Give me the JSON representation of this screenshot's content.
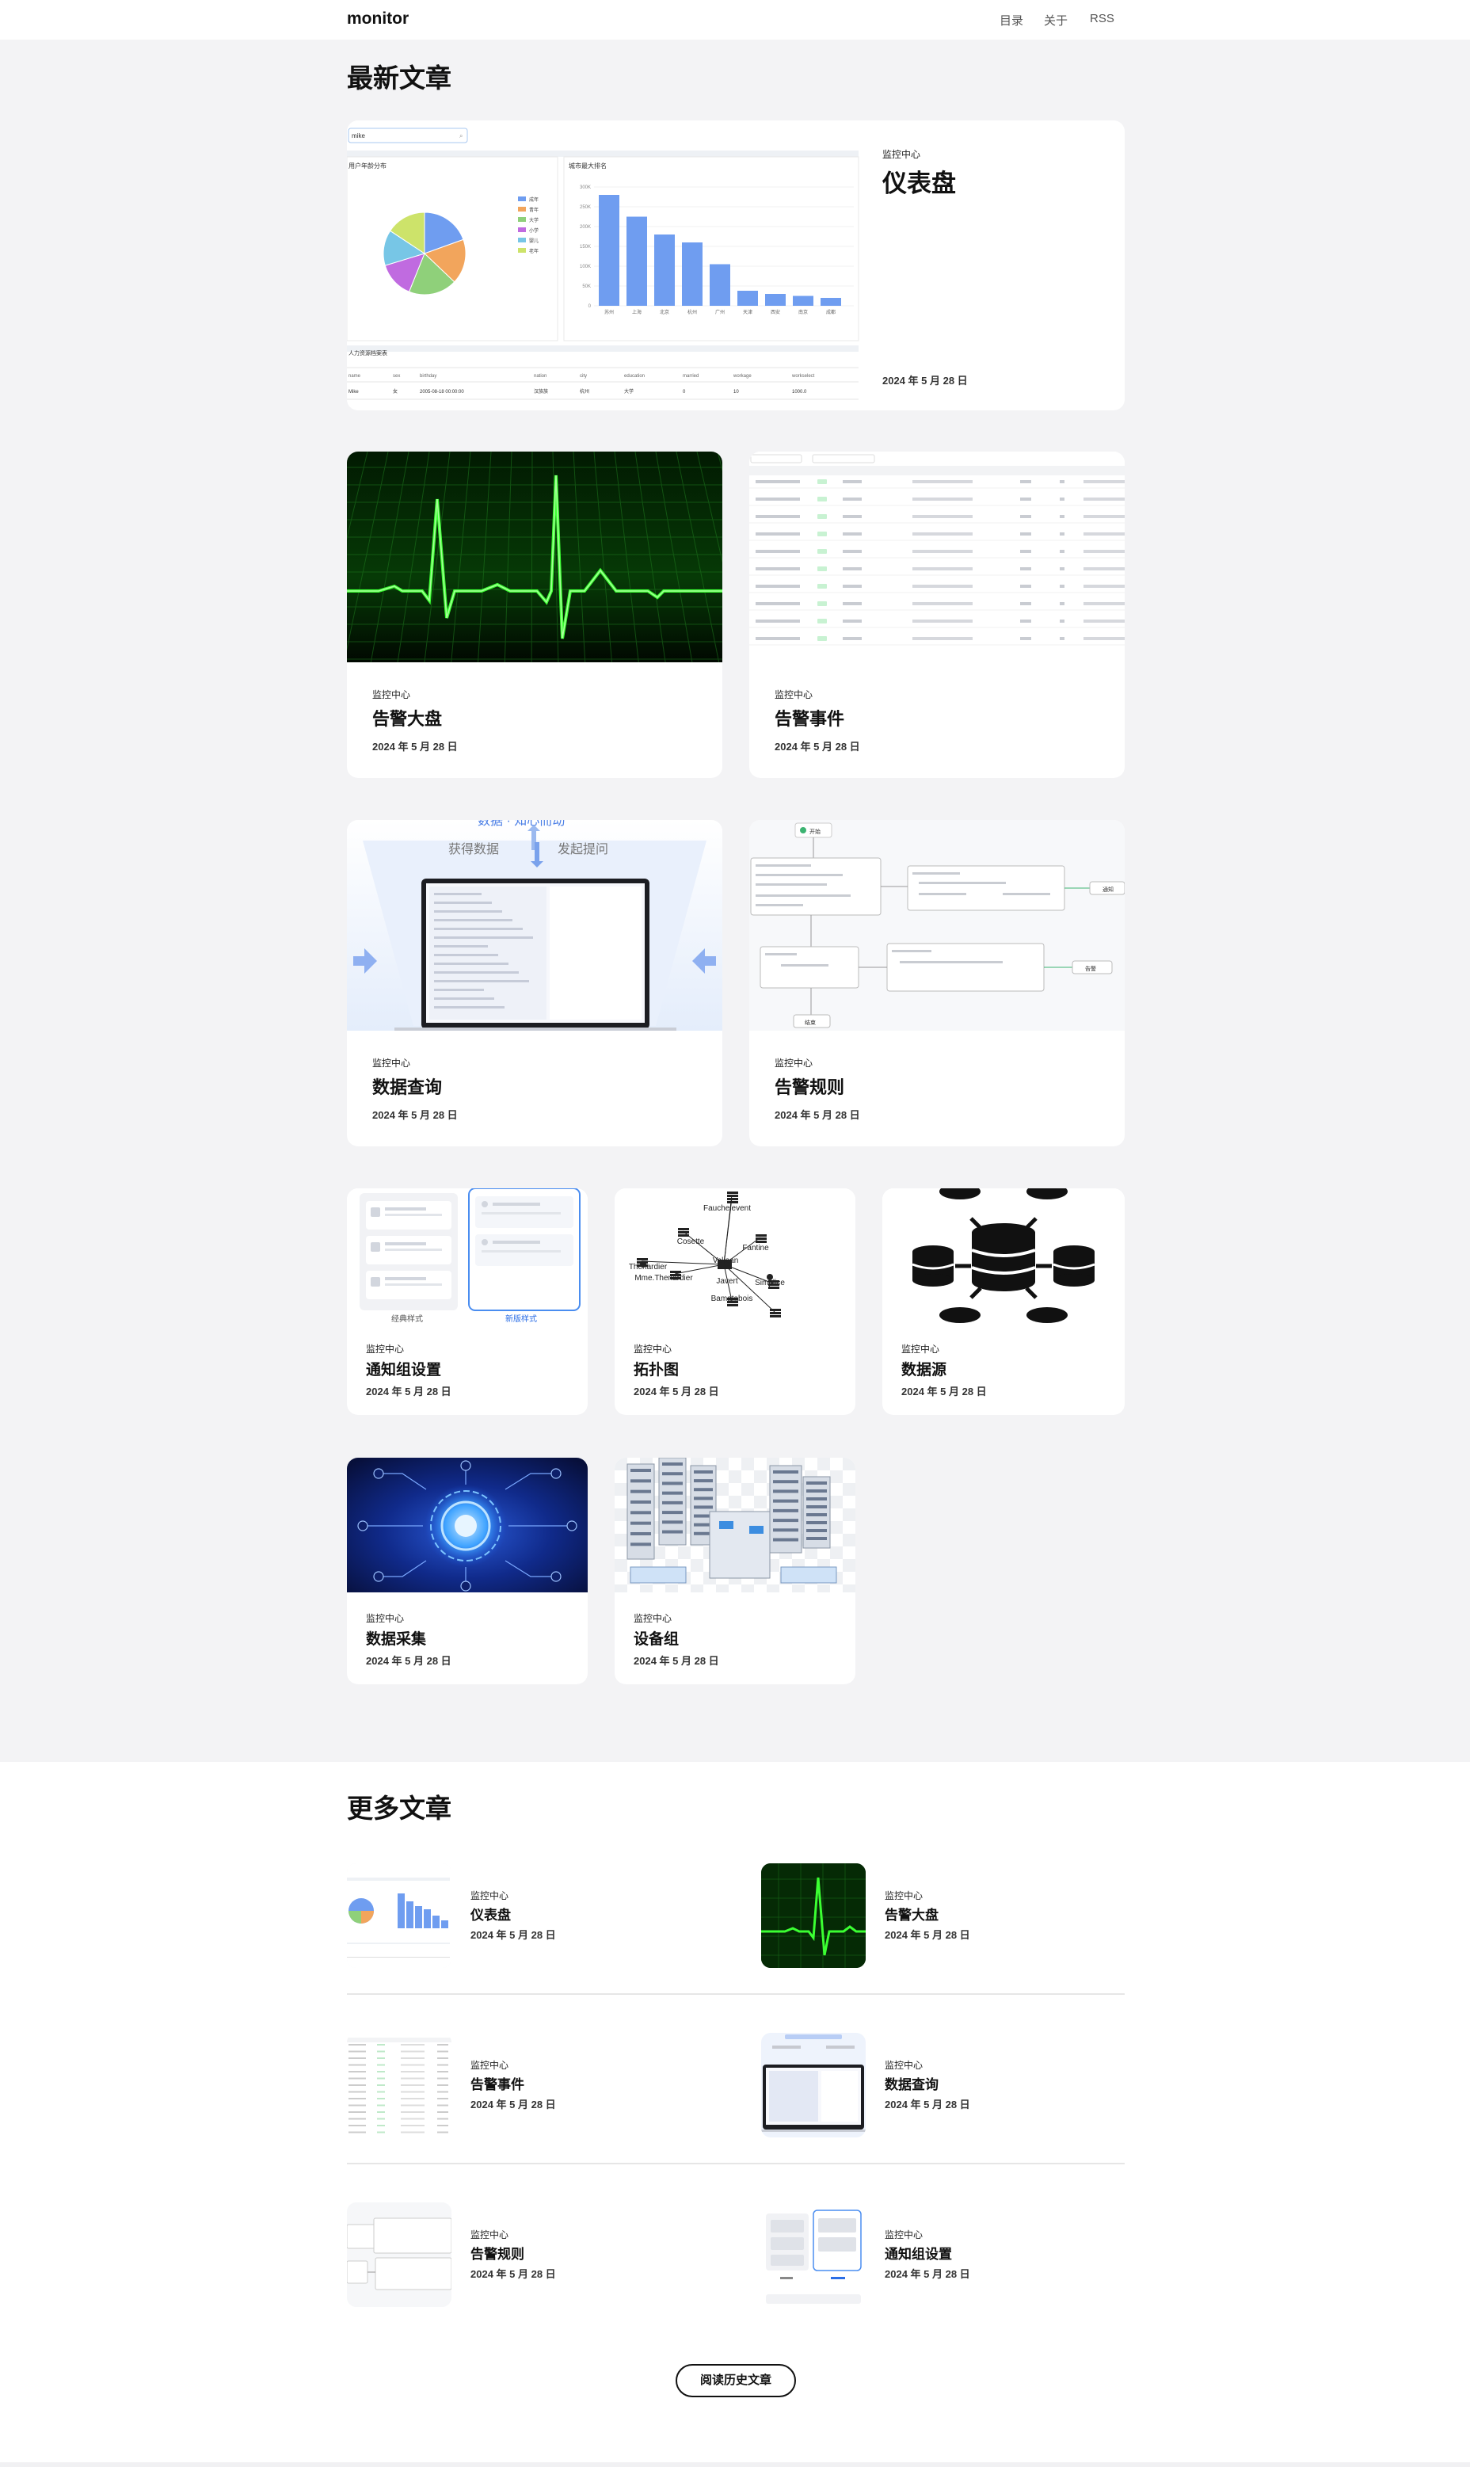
{
  "header": {
    "logo": "monitor",
    "nav": [
      "目录",
      "关于",
      "RSS"
    ]
  },
  "latest": {
    "heading": "最新文章"
  },
  "featured": {
    "category": "监控中心",
    "title": "仪表盘",
    "date": "2024 年 5 月 28 日"
  },
  "featured_thumb": {
    "search_value": "mike",
    "pie_title": "用户年龄分布",
    "pie_legend": [
      "成年",
      "青年",
      "大学",
      "小学",
      "婴儿",
      "老年"
    ],
    "pie_slices": [
      {
        "label": "成年",
        "percent": 19.5,
        "color": "#6f9df0"
      },
      {
        "label": "青年",
        "percent": 17.6,
        "color": "#f2a55c"
      },
      {
        "label": "大学",
        "percent": 19.0,
        "color": "#8fd07a"
      },
      {
        "label": "小学",
        "percent": 14.2,
        "color": "#c06be0"
      },
      {
        "label": "婴儿",
        "percent": 14.0,
        "color": "#77c6e6"
      },
      {
        "label": "老年",
        "percent": 15.7,
        "color": "#cde36a"
      }
    ],
    "bar_title": "城市最大排名",
    "bar_cities": [
      "苏州",
      "上海",
      "北京",
      "杭州",
      "广州",
      "天津",
      "西安",
      "南京",
      "成都"
    ],
    "bar_values": [
      280,
      225,
      180,
      160,
      105,
      38,
      30,
      25,
      20
    ],
    "bar_ticks": [
      "300K",
      "250K",
      "200K",
      "150K",
      "100K",
      "50K",
      "0"
    ],
    "table_title": "人力资源档案表",
    "table_headers": [
      "name",
      "sex",
      "birthday",
      "nation",
      "city",
      "education",
      "married",
      "workage",
      "workselect"
    ],
    "table_row": [
      "Mike",
      "女",
      "2005-08-18 00:00:00",
      "汉族族",
      "杭州",
      "大学",
      "0",
      "10",
      "1000.0"
    ]
  },
  "cards": [
    {
      "category": "监控中心",
      "title": "告警大盘",
      "date": "2024 年 5 月 28 日",
      "icon": "ecg-icon"
    },
    {
      "category": "监控中心",
      "title": "告警事件",
      "date": "2024 年 5 月 28 日",
      "icon": "event-table-icon"
    },
    {
      "category": "监控中心",
      "title": "数据查询",
      "date": "2024 年 5 月 28 日",
      "icon": "laptop-query-icon"
    },
    {
      "category": "监控中心",
      "title": "告警规则",
      "date": "2024 年 5 月 28 日",
      "icon": "flow-rule-icon"
    },
    {
      "category": "监控中心",
      "title": "通知组设置",
      "date": "2024 年 5 月 28 日",
      "icon": "notify-group-icon"
    },
    {
      "category": "监控中心",
      "title": "拓扑图",
      "date": "2024 年 5 月 28 日",
      "icon": "topology-icon"
    },
    {
      "category": "监控中心",
      "title": "数据源",
      "date": "2024 年 5 月 28 日",
      "icon": "database-icon"
    },
    {
      "category": "监控中心",
      "title": "数据采集",
      "date": "2024 年 5 月 28 日",
      "icon": "data-collect-icon"
    },
    {
      "category": "监控中心",
      "title": "设备组",
      "date": "2024 年 5 月 28 日",
      "icon": "server-group-icon"
    }
  ],
  "query_thumb": {
    "top": "数据 · 知心而动",
    "left": "获得数据",
    "right": "发起提问"
  },
  "rule_thumb": {
    "start": "开始",
    "end": "结束",
    "notify": "通知",
    "alarm": "告警"
  },
  "notify_thumb": {
    "left": "经典样式",
    "right": "新版样式"
  },
  "topo_thumb": {
    "nodes": [
      "Fauchelevent",
      "Cosette",
      "Valjean",
      "Fantine",
      "Thenardier",
      "Mme.Thenardier",
      "Javert",
      "Simplice",
      "Bamatabois"
    ]
  },
  "more": {
    "heading": "更多文章",
    "button": "阅读历史文章",
    "items": [
      {
        "category": "监控中心",
        "title": "仪表盘",
        "date": "2024 年 5 月 28 日"
      },
      {
        "category": "监控中心",
        "title": "告警大盘",
        "date": "2024 年 5 月 28 日"
      },
      {
        "category": "监控中心",
        "title": "告警事件",
        "date": "2024 年 5 月 28 日"
      },
      {
        "category": "监控中心",
        "title": "数据查询",
        "date": "2024 年 5 月 28 日"
      },
      {
        "category": "监控中心",
        "title": "告警规则",
        "date": "2024 年 5 月 28 日"
      },
      {
        "category": "监控中心",
        "title": "通知组设置",
        "date": "2024 年 5 月 28 日"
      }
    ]
  },
  "colors": {
    "accent": "#2b6ee6",
    "ecg_green": "#3bff32",
    "bar_blue": "#6f9df0",
    "bg": "#f3f3f5"
  }
}
